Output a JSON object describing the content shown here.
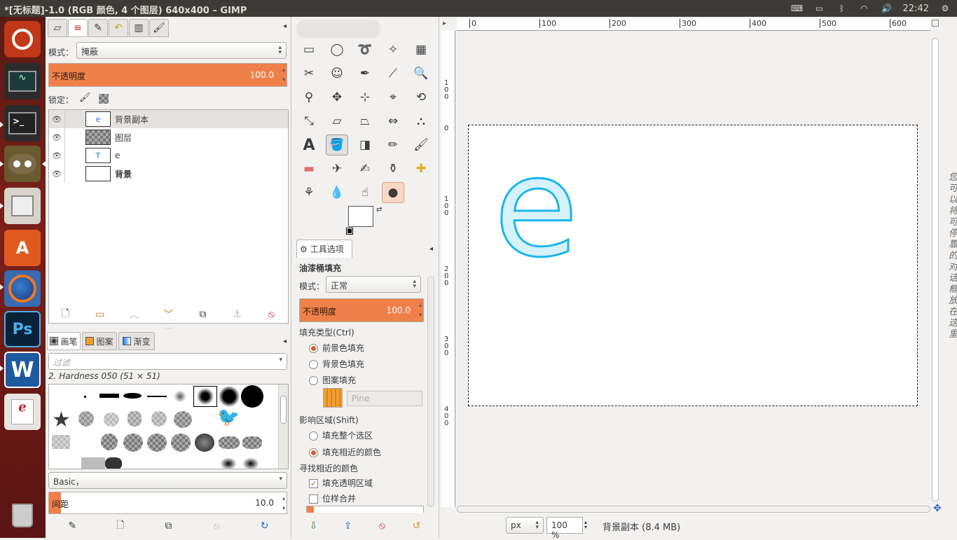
{
  "window": {
    "title": "*[无标题]-1.0 (RGB 颜色, 4 个图层) 640x400 – GIMP"
  },
  "tray": {
    "clock": "22:42"
  },
  "launcher": {
    "items": [
      "ubuntu-dash",
      "system-monitor",
      "terminal",
      "gimp",
      "files",
      "software-center",
      "firefox",
      "photoshop",
      "wps-writer",
      "document-viewer",
      "trash"
    ],
    "ps_label": "Ps",
    "w_label": "W",
    "a_label": "A"
  },
  "layers": {
    "mode_label": "模式：",
    "mode_value": "掩蔽",
    "opacity_label": "不透明度",
    "opacity_value": "100.0",
    "opacity_fraction": 1.0,
    "lock_label": "锁定：",
    "items": [
      {
        "name": "背景副本",
        "thumb": "e",
        "bold": false,
        "selected": true
      },
      {
        "name": "图层",
        "thumb": "",
        "bold": false,
        "selected": false
      },
      {
        "name": "e",
        "thumb": "T",
        "bold": false,
        "selected": false
      },
      {
        "name": "背景",
        "thumb": "",
        "bold": true,
        "selected": false
      }
    ]
  },
  "brushes": {
    "tabs": [
      "画笔",
      "图案",
      "渐变"
    ],
    "filter_placeholder": "过滤",
    "current": "2. Hardness 050 (51 × 51)",
    "preset": "Basic，",
    "spacing_label": "间距",
    "spacing_value": "10.0",
    "spacing_fraction": 0.05
  },
  "tool_options": {
    "tab_label": "工具选项",
    "tool_name": "油漆桶填充",
    "mode_label": "模式：",
    "mode_value": "正常",
    "opacity_label": "不透明度",
    "opacity_value": "100.0",
    "opacity_fraction": 1.0,
    "fill_type_label": "填充类型(Ctrl)",
    "fill_fg": "前景色填充",
    "fill_bg": "背景色填充",
    "fill_pattern": "图案填充",
    "pattern_name": "Pine",
    "affected_label": "影响区域(Shift)",
    "affected_whole": "填充整个选区",
    "affected_similar": "填充相近的颜色",
    "find_label": "寻找相近的颜色",
    "fill_transparent": "填充透明区域",
    "sample_merged": "位样合并"
  },
  "colors": {
    "accent": "#f08049",
    "foreground": "#ffffff",
    "background": "#0a7ff0",
    "letter_stroke": "#1ab6ee",
    "letter_fill": "#d6f2ff"
  },
  "canvas": {
    "letter": "e",
    "hruler_ticks": [
      "0",
      "100",
      "200",
      "300",
      "400",
      "500",
      "600"
    ],
    "vruler_ticks": [
      "1\n0\n0",
      "0",
      "1\n0\n0",
      "2\n0\n0",
      "3\n0\n0",
      "4\n0\n0"
    ],
    "unit": "px",
    "zoom": "100 %",
    "status": "背景副本 (8.4 MB)",
    "side_hint": "您可以将可停靠的对话框放在这里"
  }
}
